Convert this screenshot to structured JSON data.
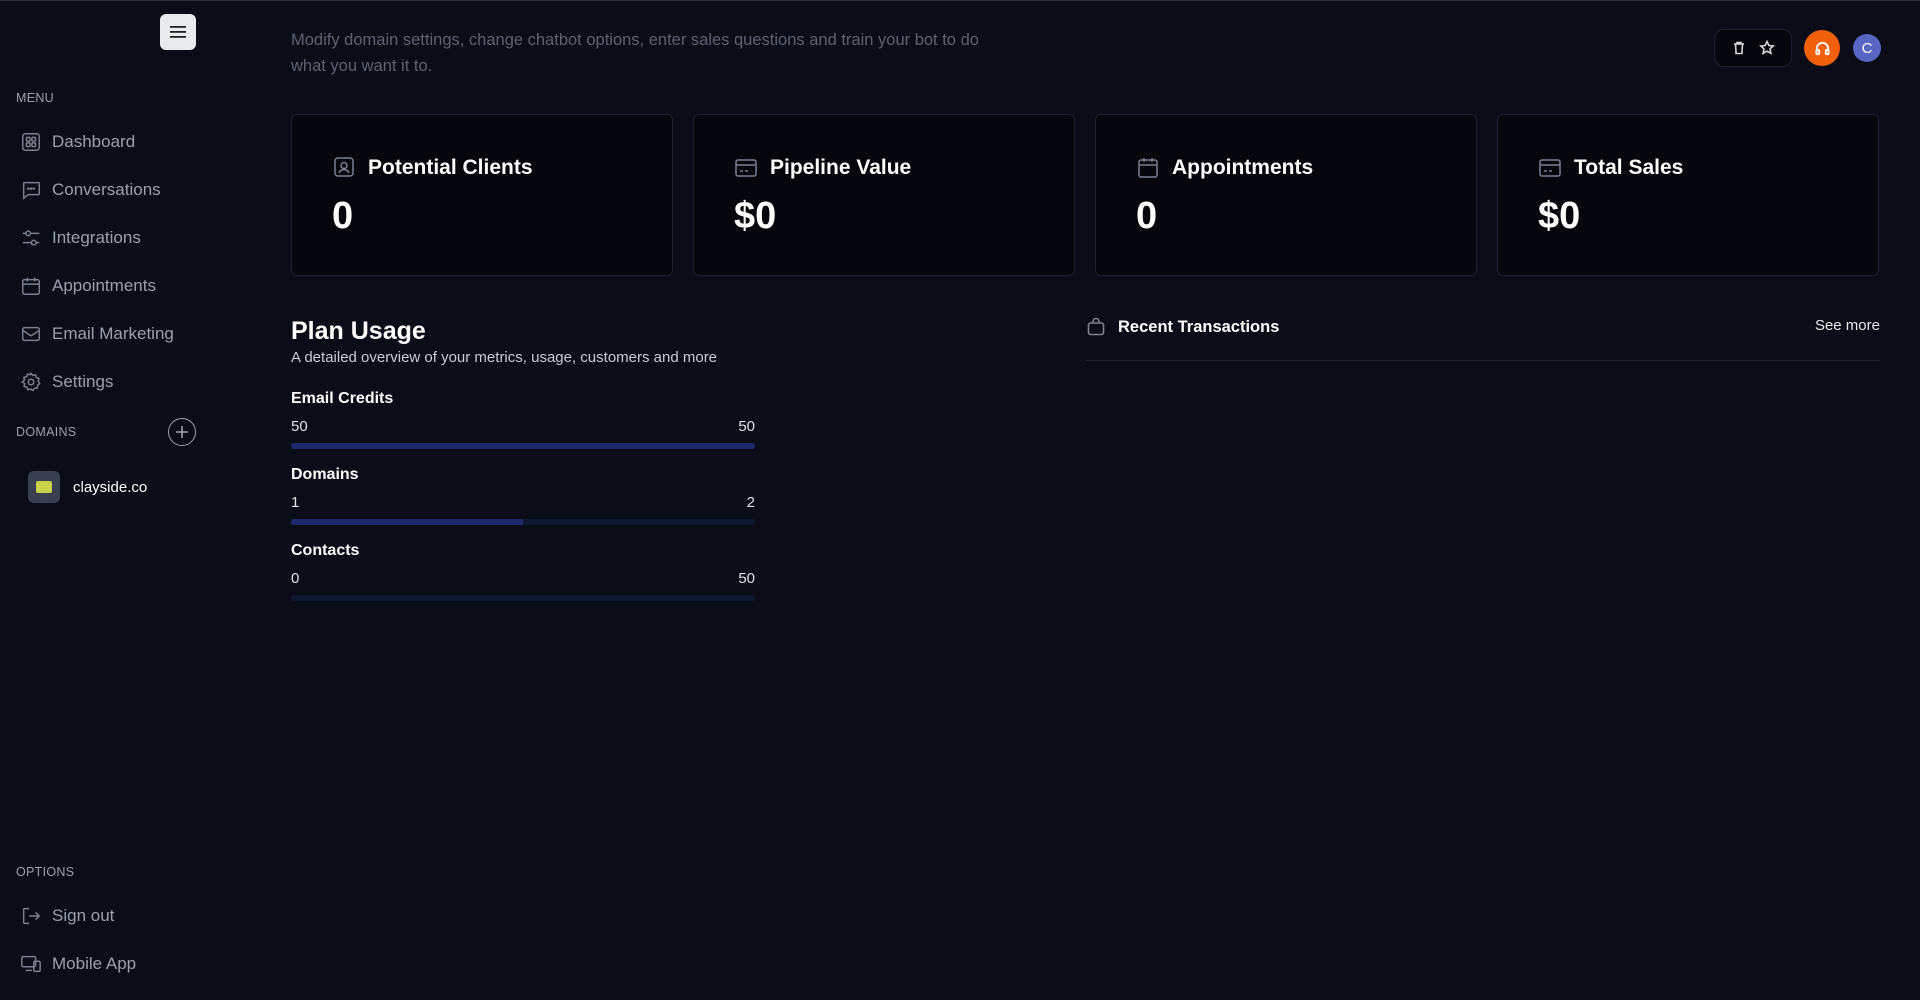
{
  "sidebar": {
    "menu_label": "MENU",
    "items": [
      {
        "label": "Dashboard",
        "icon": "dashboard-icon"
      },
      {
        "label": "Conversations",
        "icon": "chat-icon"
      },
      {
        "label": "Integrations",
        "icon": "sliders-icon"
      },
      {
        "label": "Appointments",
        "icon": "calendar-icon"
      },
      {
        "label": "Email Marketing",
        "icon": "mail-icon"
      },
      {
        "label": "Settings",
        "icon": "gear-icon"
      }
    ],
    "domains_label": "DOMAINS",
    "domains": [
      {
        "name": "clayside.co"
      }
    ],
    "options_label": "OPTIONS",
    "options": [
      {
        "label": "Sign out",
        "icon": "sign-out-icon"
      },
      {
        "label": "Mobile App",
        "icon": "devices-icon"
      }
    ]
  },
  "header": {
    "subtitle": "Modify domain settings, change chatbot options, enter sales questions and train your bot to do what you want it to.",
    "avatar_initial": "C"
  },
  "stats": [
    {
      "title": "Potential Clients",
      "value": "0",
      "icon": "person-badge-icon"
    },
    {
      "title": "Pipeline Value",
      "value": "$0",
      "icon": "card-icon"
    },
    {
      "title": "Appointments",
      "value": "0",
      "icon": "calendar-icon"
    },
    {
      "title": "Total Sales",
      "value": "$0",
      "icon": "card-icon"
    }
  ],
  "plan": {
    "title": "Plan Usage",
    "description": "A detailed overview of your metrics, usage, customers and more",
    "items": [
      {
        "label": "Email Credits",
        "used": "50",
        "limit": "50",
        "fraction": 1.0
      },
      {
        "label": "Domains",
        "used": "1",
        "limit": "2",
        "fraction": 0.5
      },
      {
        "label": "Contacts",
        "used": "0",
        "limit": "50",
        "fraction": 0.0
      }
    ]
  },
  "transactions": {
    "title": "Recent Transactions",
    "see_more": "See more"
  },
  "colors": {
    "background": "#0a0d17",
    "card": "#05070c",
    "accent_orange": "#f2600c",
    "avatar": "#5865c2",
    "progress_fill": "#1c2a6b"
  }
}
